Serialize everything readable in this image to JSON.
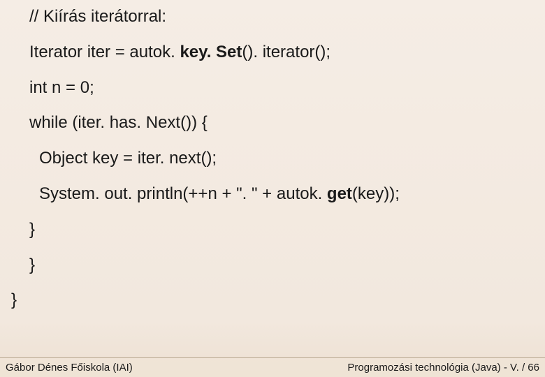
{
  "code": {
    "line1": "// Kiírás iterátorral:",
    "line2_pre": "Iterator iter = autok. ",
    "line2_bold": "key. Set",
    "line2_post": "(). iterator();",
    "line3": "int n = 0;",
    "line4": "while (iter. has. Next()) {",
    "line5": "Object key = iter. next();",
    "line6_pre": "System. out. println(++n + \". \" + autok. ",
    "line6_bold": "get",
    "line6_post": "(key));",
    "line7": "}",
    "line8": "}",
    "line9": "}"
  },
  "footer": {
    "left": "Gábor Dénes Főiskola (IAI)",
    "right": "Programozási technológia (Java)  -  V. / 66"
  }
}
